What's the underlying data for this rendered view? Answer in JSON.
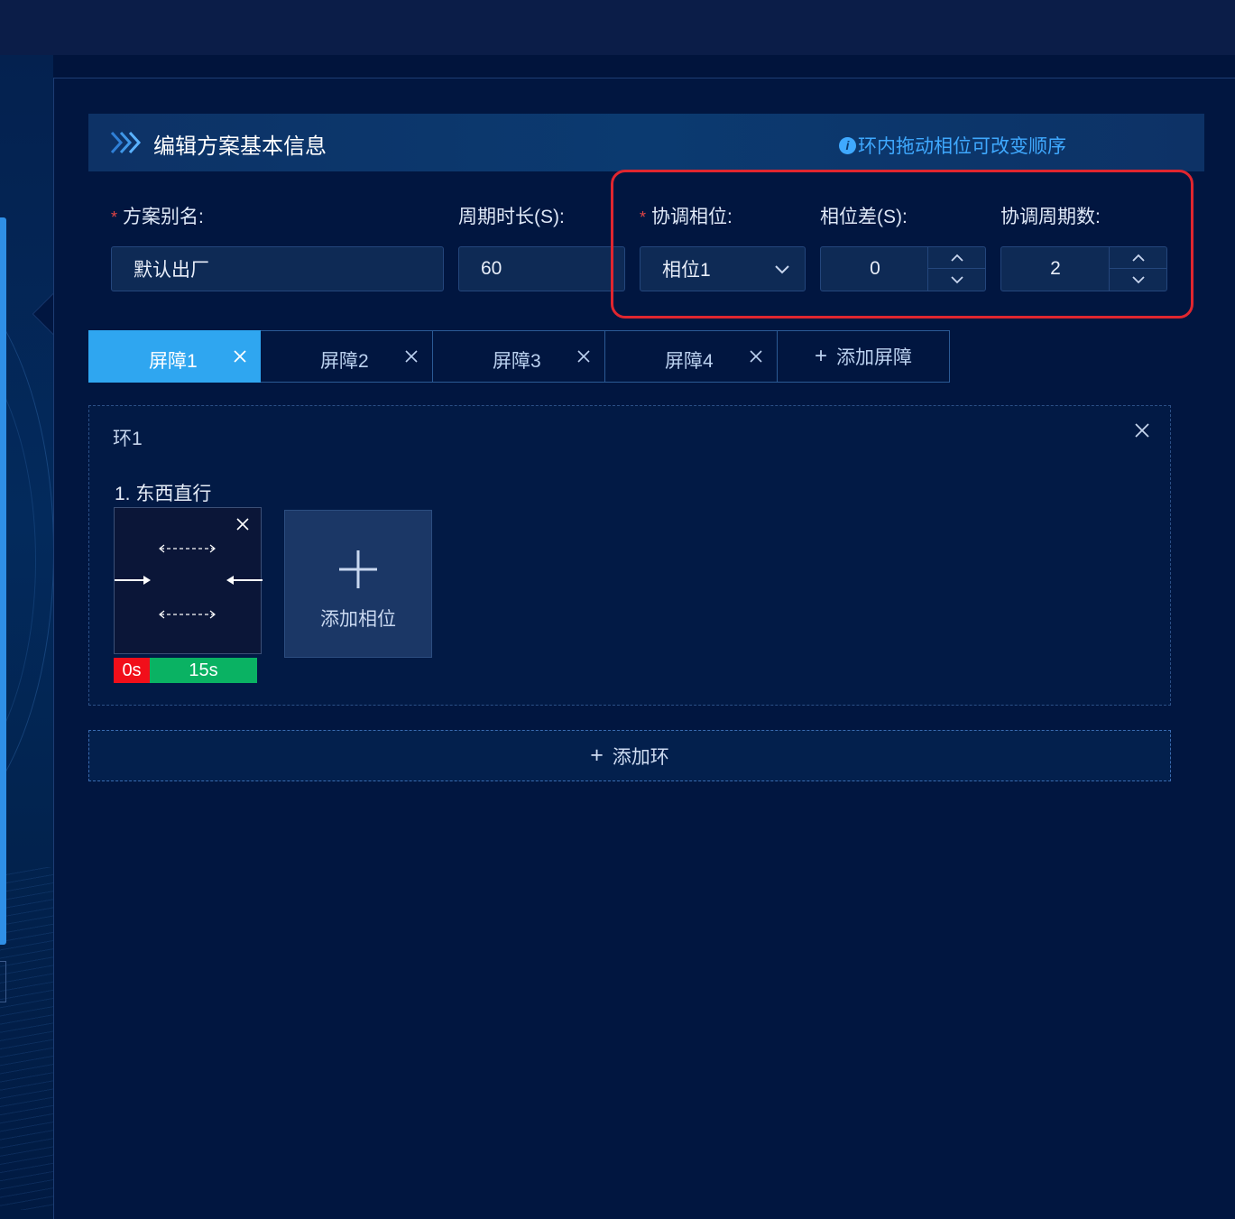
{
  "colors": {
    "background": "#01143c",
    "accent": "#2fa6f0",
    "tip": "#3fa9ff",
    "required": "#e04545",
    "highlight": "#e0262f",
    "red_segment": "#f10f1a",
    "green_segment": "#0ab263"
  },
  "header": {
    "icon": "double-chevron-right-icon",
    "title": "编辑方案基本信息",
    "tip_icon": "info-icon",
    "tip": "环内拖动相位可改变顺序"
  },
  "form": {
    "alias_label": "方案别名:",
    "alias_required": "*",
    "alias_value": "默认出厂",
    "cycle_label": "周期时长(S):",
    "cycle_value": "60",
    "coord_phase_label": "协调相位:",
    "coord_phase_required": "*",
    "coord_phase_value": "相位1",
    "offset_label": "相位差(S):",
    "offset_value": "0",
    "coord_cycles_label": "协调周期数:",
    "coord_cycles_value": "2"
  },
  "tabs": [
    {
      "label": "屏障1",
      "active": true
    },
    {
      "label": "屏障2",
      "active": false
    },
    {
      "label": "屏障3",
      "active": false
    },
    {
      "label": "屏障4",
      "active": false
    }
  ],
  "add_barrier": {
    "icon": "plus-icon",
    "label": "添加屏障"
  },
  "ring": {
    "title": "环1",
    "phase_title": "1. 东西直行",
    "phase_icon": "east-west-through-arrows-icon",
    "red_time": "0s",
    "green_time": "15s",
    "add_phase_label": "添加相位"
  },
  "add_ring": {
    "icon": "plus-icon",
    "label": "添加环"
  }
}
